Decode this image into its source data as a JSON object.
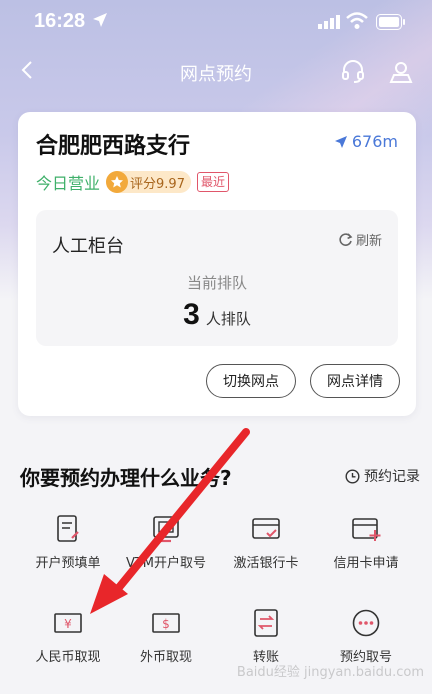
{
  "status_bar": {
    "time": "16:28"
  },
  "navbar": {
    "title": "网点预约"
  },
  "branch": {
    "name": "合肥肥西路支行",
    "distance": "676m",
    "open_status": "今日营业",
    "rating": "评分9.97",
    "recent_badge": "最近"
  },
  "queue": {
    "title": "人工柜台",
    "refresh_label": "刷新",
    "label": "当前排队",
    "count": "3",
    "unit": "人排队"
  },
  "card_buttons": {
    "switch": "切换网点",
    "detail": "网点详情"
  },
  "services": {
    "title": "你要预约办理什么业务?",
    "history_label": "预约记录",
    "items": [
      {
        "label": "开户预填单",
        "icon": "form-edit-icon"
      },
      {
        "label": "VTM开户取号",
        "icon": "vtm-screen-icon"
      },
      {
        "label": "激活银行卡",
        "icon": "card-check-icon"
      },
      {
        "label": "信用卡申请",
        "icon": "card-plus-icon"
      },
      {
        "label": "人民币取现",
        "icon": "rmb-note-icon"
      },
      {
        "label": "外币取现",
        "icon": "foreign-currency-icon"
      },
      {
        "label": "转账",
        "icon": "transfer-icon"
      },
      {
        "label": "预约取号",
        "icon": "more-dots-icon"
      }
    ]
  },
  "watermark": "Baidu经验 jingyan.baidu.com",
  "colors": {
    "accent_blue": "#4a78d8",
    "open_green": "#3fb06a",
    "badge_red": "#e0566a",
    "icon_red": "#e0566a",
    "arrow_red": "#e8262a"
  }
}
